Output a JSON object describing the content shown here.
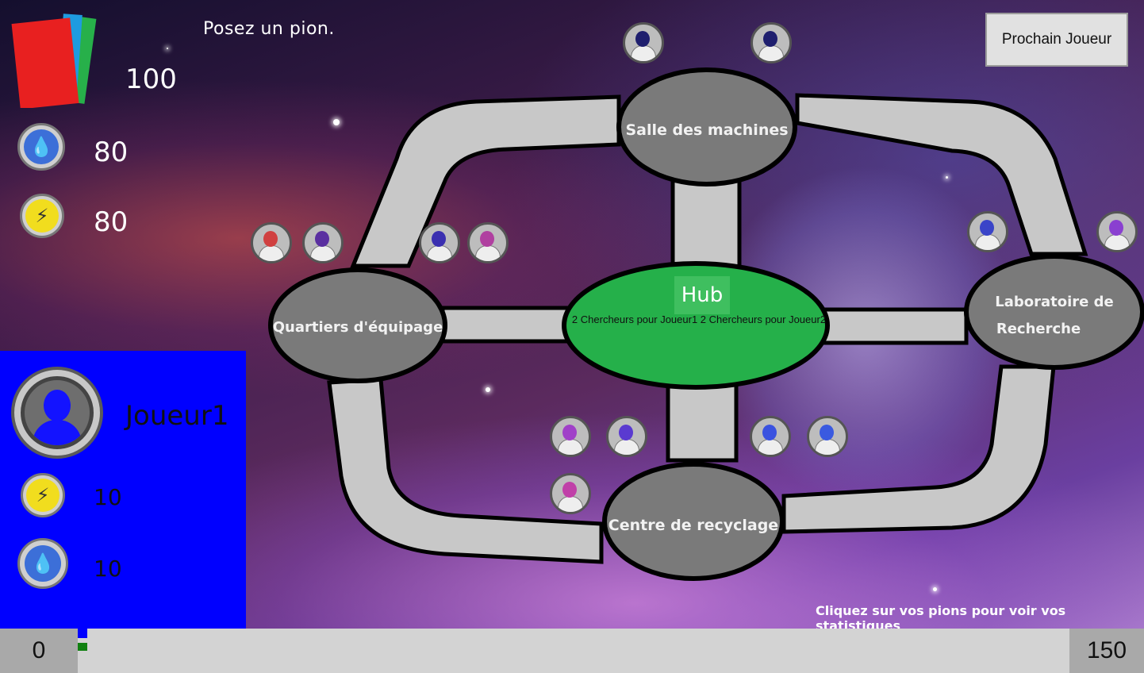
{
  "status": {
    "message": "Posez un pion."
  },
  "next_button": {
    "label": "Prochain Joueur"
  },
  "resources": {
    "cards": {
      "value": "100",
      "icon": "cards-icon",
      "colors": [
        "#e82020",
        "#1e9be0",
        "#27b04a"
      ]
    },
    "water": {
      "value": "80",
      "icon": "water-drop-icon"
    },
    "energy": {
      "value": "80",
      "icon": "lightning-icon"
    }
  },
  "player_panel": {
    "name": "Joueur1",
    "energy": "10",
    "water": "10",
    "color": "#0000ff"
  },
  "rooms": {
    "machines": "Salle des machines",
    "quarters": "Quartiers d'équipage",
    "lab_line1": "Laboratoire de",
    "lab_line2": "Recherche",
    "recycling": "Centre de recyclage",
    "hub": "Hub",
    "hub_status": "2 Chercheurs pour Joueur1 2 Chercheurs pour Joueur2"
  },
  "hint": "Cliquez sur vos pions pour voir vos statistiques",
  "progress": {
    "min": "0",
    "max": "150",
    "player1_value": 0,
    "player2_value": 0
  },
  "pawns": [
    {
      "slot": "machines-1",
      "color": "#1e1e6e"
    },
    {
      "slot": "machines-2",
      "color": "#1e1e6e"
    },
    {
      "slot": "quarters-1",
      "color": "#d04040"
    },
    {
      "slot": "quarters-2",
      "color": "#5a2fa0"
    },
    {
      "slot": "quarters-3",
      "color": "#3a2fb0"
    },
    {
      "slot": "quarters-4",
      "color": "#b040a0"
    },
    {
      "slot": "lab-1",
      "color": "#3a44c8"
    },
    {
      "slot": "lab-2",
      "color": "#8a40d0"
    },
    {
      "slot": "recycling-1",
      "color": "#a040c8"
    },
    {
      "slot": "recycling-2",
      "color": "#5a3ad0"
    },
    {
      "slot": "recycling-3",
      "color": "#3a52e0"
    },
    {
      "slot": "recycling-4",
      "color": "#3a5ae0"
    },
    {
      "slot": "recycling-5",
      "color": "#c040a8"
    }
  ]
}
